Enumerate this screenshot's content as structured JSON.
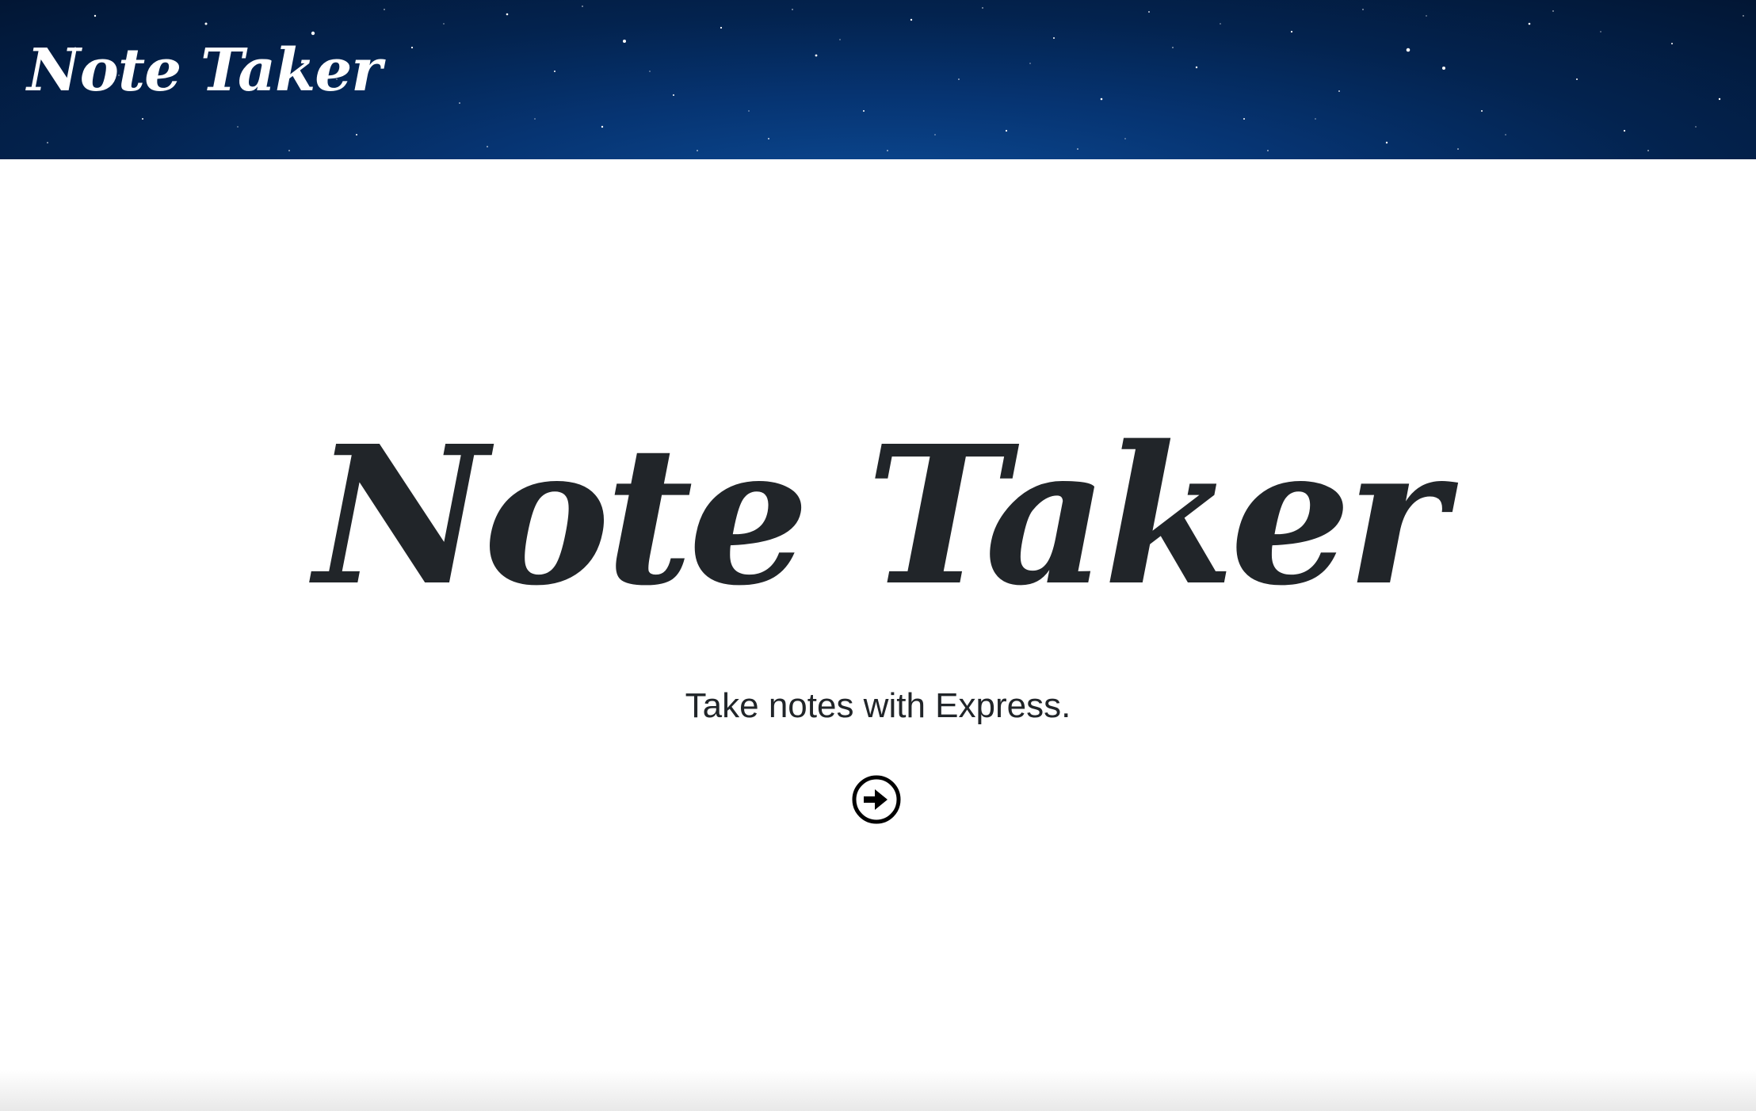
{
  "navbar": {
    "brand": "Note Taker",
    "background": "#063472"
  },
  "hero": {
    "title": "Note Taker",
    "lead": "Take notes with Express.",
    "button_icon": "arrow-circle-right-icon"
  },
  "colors": {
    "text": "#212529",
    "brand_text": "#ffffff"
  }
}
